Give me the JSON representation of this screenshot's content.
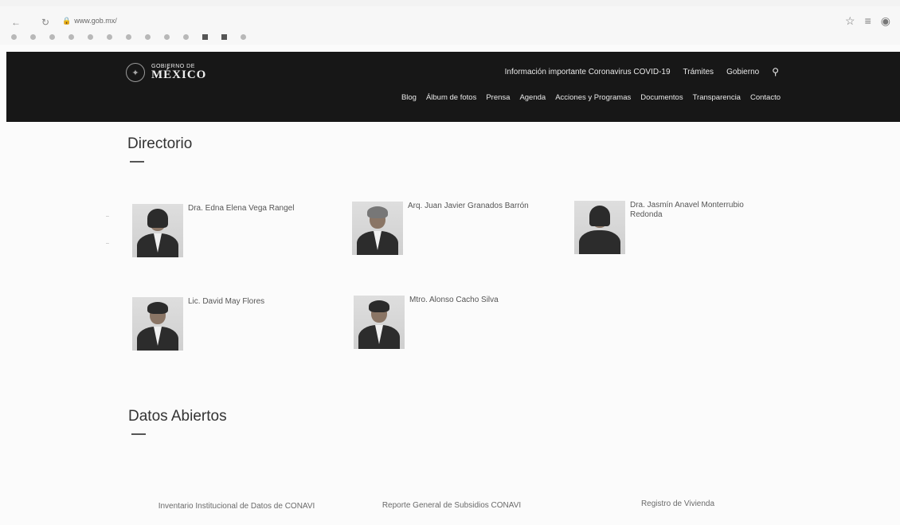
{
  "browser": {
    "url": "www.gob.mx/",
    "bookmarks": [
      "",
      "",
      "",
      "",
      "",
      "",
      "",
      "",
      "",
      "",
      "",
      "",
      ""
    ]
  },
  "header": {
    "logo_line1": "GOBIERNO DE",
    "logo_line2": "MÉXICO",
    "top_nav": [
      "Información importante Coronavirus COVID-19",
      "Trámites",
      "Gobierno"
    ],
    "main_nav": [
      "Blog",
      "Álbum de fotos",
      "Prensa",
      "Agenda",
      "Acciones y Programas",
      "Documentos",
      "Transparencia",
      "Contacto"
    ]
  },
  "directorio": {
    "title": "Directorio",
    "people": [
      {
        "name": "Dra. Edna Elena Vega Rangel",
        "role": ""
      },
      {
        "name": "Arq. Juan Javier Granados Barrón",
        "role": ""
      },
      {
        "name": "Dra. Jasmín Anavel Monterrubio Redonda",
        "role": ""
      },
      {
        "name": "Lic. David May Flores",
        "role": ""
      },
      {
        "name": "Mtro. Alonso Cacho Silva",
        "role": ""
      }
    ]
  },
  "datos_abiertos": {
    "title": "Datos Abiertos",
    "links": [
      "Inventario Institucional de Datos de CONAVI",
      "Reporte General de Subsidios CONAVI",
      "Registro de Vivienda"
    ]
  }
}
